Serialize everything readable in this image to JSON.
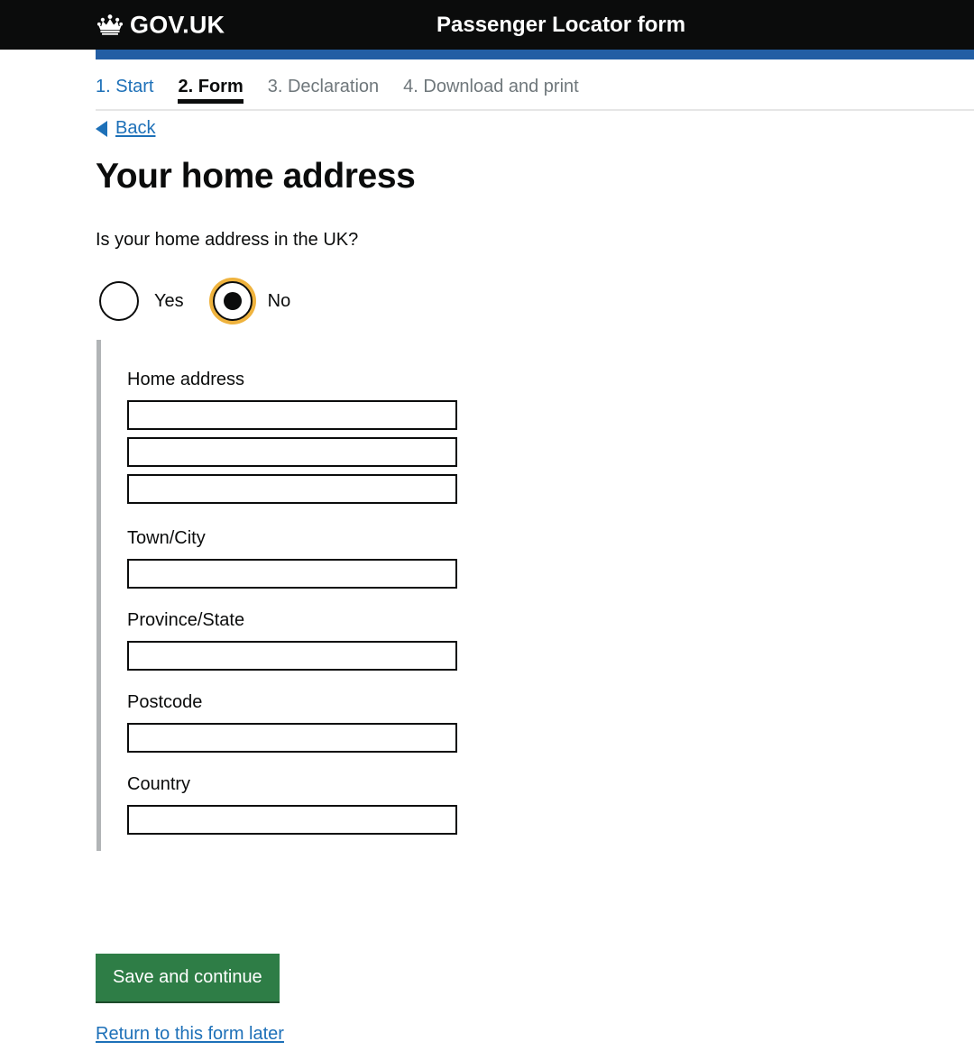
{
  "header": {
    "logo_text": "GOV.UK",
    "logo_icon": "crown-icon",
    "service_name": "Passenger Locator form",
    "background_color": "#0b0c0c",
    "accent_bar_color": "#235ea4"
  },
  "step_nav": {
    "steps": [
      {
        "label": "1. Start",
        "state": "link"
      },
      {
        "label": "2. Form",
        "state": "current"
      },
      {
        "label": "3. Declaration",
        "state": "muted"
      },
      {
        "label": "4. Download and print",
        "state": "muted"
      }
    ]
  },
  "back_link": {
    "label": "Back",
    "icon": "left-triangle-icon"
  },
  "main": {
    "heading": "Your home address",
    "question": "Is your home address in the UK?",
    "radios": {
      "options": [
        {
          "label": "Yes",
          "selected": false,
          "focused": false
        },
        {
          "label": "No",
          "selected": true,
          "focused": true
        }
      ],
      "focus_ring_color": "#efb33e"
    },
    "reveal_panel": {
      "border_color": "#b1b4b6",
      "fields": [
        {
          "label": "Home address",
          "inputs": [
            {
              "value": "",
              "placeholder": ""
            },
            {
              "value": "",
              "placeholder": ""
            },
            {
              "value": "",
              "placeholder": ""
            }
          ]
        },
        {
          "label": "Town/City",
          "inputs": [
            {
              "value": "",
              "placeholder": ""
            }
          ]
        },
        {
          "label": "Province/State",
          "inputs": [
            {
              "value": "",
              "placeholder": ""
            }
          ]
        },
        {
          "label": "Postcode",
          "inputs": [
            {
              "value": "",
              "placeholder": ""
            }
          ]
        },
        {
          "label": "Country",
          "inputs": [
            {
              "value": "",
              "placeholder": ""
            }
          ]
        }
      ]
    }
  },
  "actions": {
    "save_label": "Save and continue",
    "save_color": "#2e7d46",
    "return_label": "Return to this form later",
    "link_color": "#1d70b8"
  }
}
